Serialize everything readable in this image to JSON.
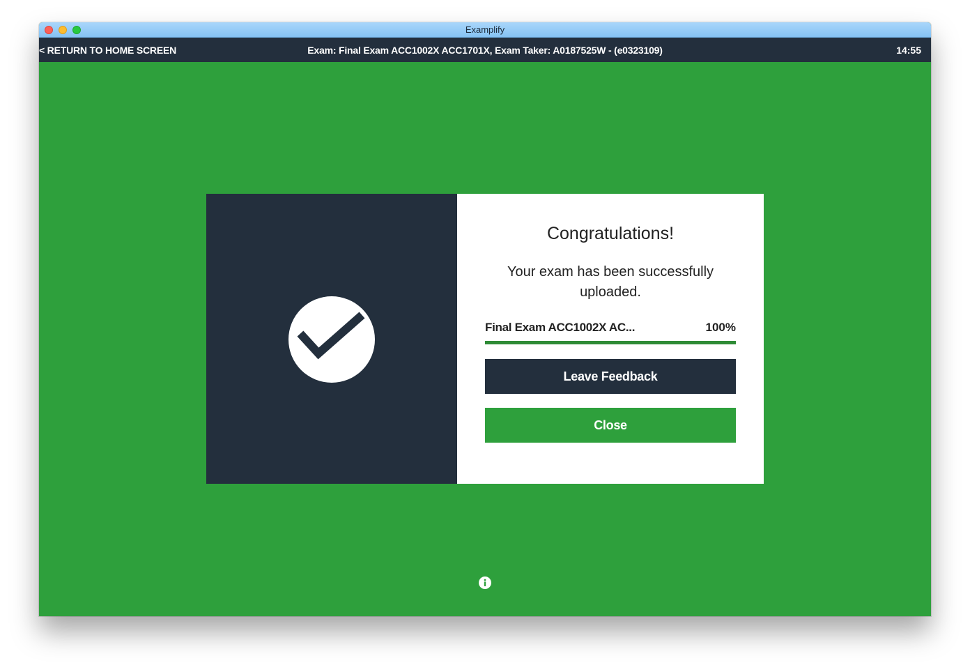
{
  "window": {
    "title": "Examplify"
  },
  "appbar": {
    "return_label": "< RETURN TO HOME SCREEN",
    "exam_info": "Exam: Final Exam ACC1002X ACC1701X, Exam Taker: A0187525W - (e0323109)",
    "time": "14:55"
  },
  "dialog": {
    "heading": "Congratulations!",
    "message": "Your exam has been successfully uploaded.",
    "upload": {
      "file_name": "Final Exam ACC1002X AC...",
      "percent_label": "100%",
      "progress_fraction": 1.0
    },
    "feedback_button": "Leave Feedback",
    "close_button": "Close",
    "status_icon": "checkmark-circle-icon"
  },
  "footer": {
    "icon": "info-icon"
  },
  "colors": {
    "background_success": "#2ea03c",
    "navy": "#232f3d",
    "progress": "#2e8b36",
    "white": "#ffffff"
  }
}
